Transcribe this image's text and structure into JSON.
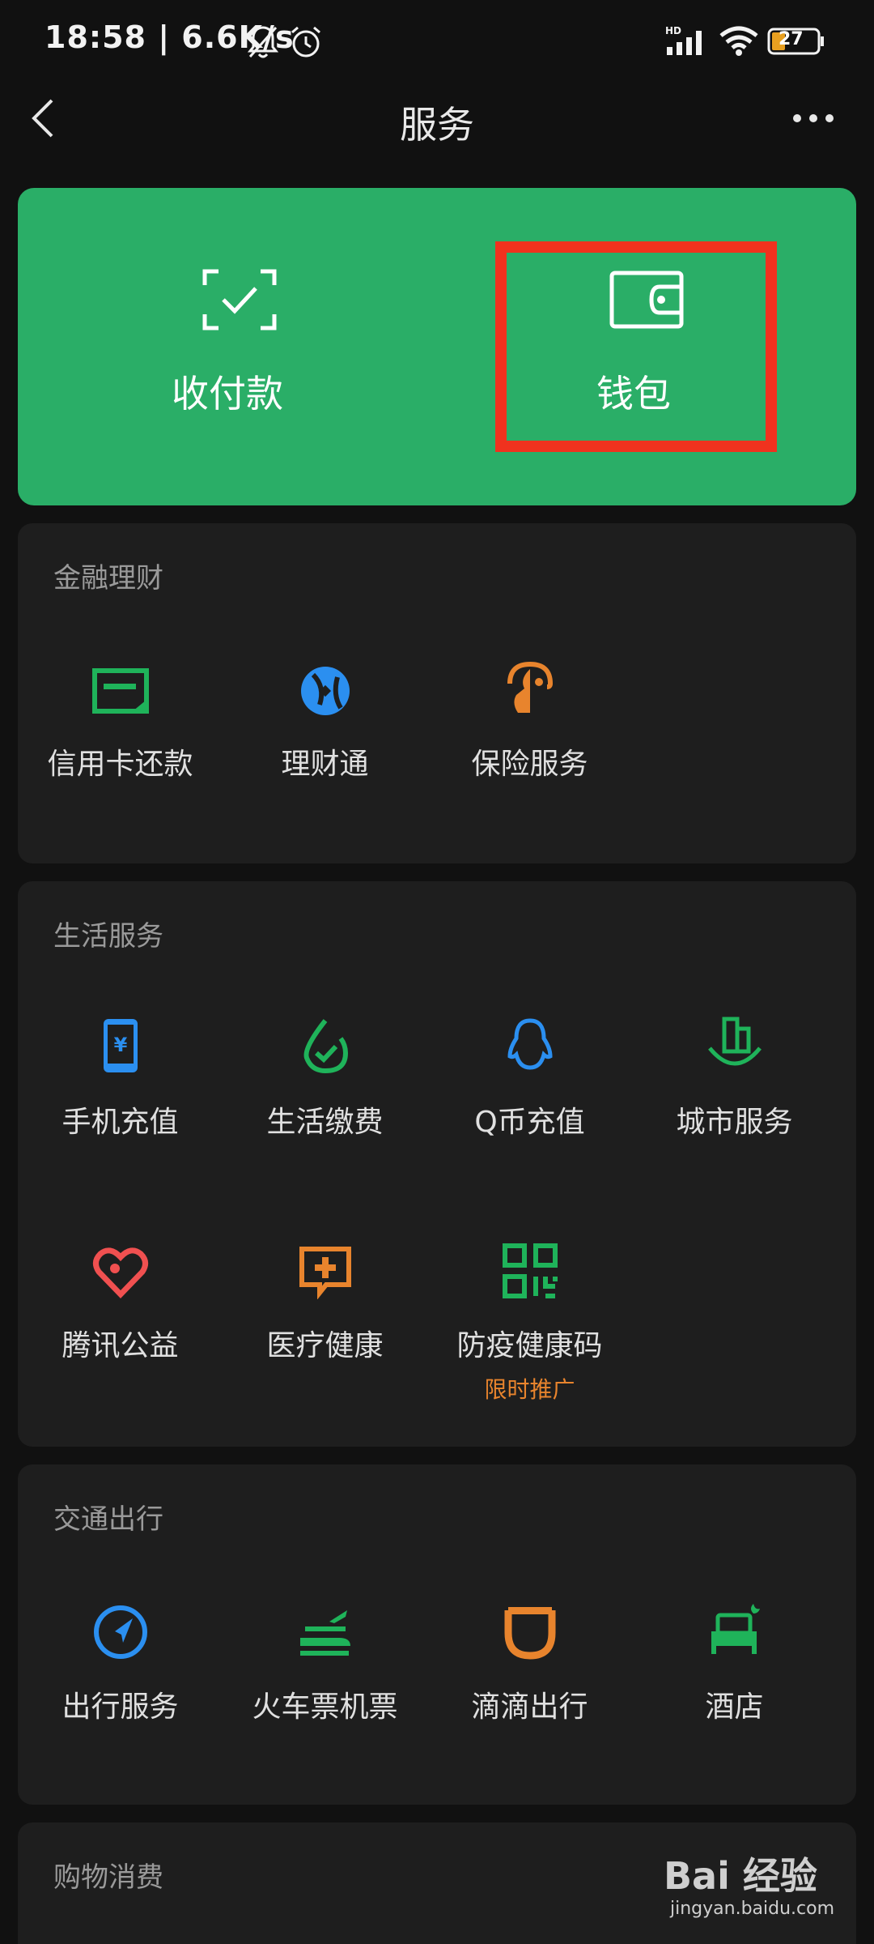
{
  "status_bar": {
    "time": "18:58 | 6.6K/s",
    "battery": "27",
    "network": "HD"
  },
  "nav": {
    "title": "服务",
    "back_icon": "chevron-left-icon",
    "more_icon": "more-icon"
  },
  "top_card": {
    "color": "#2aae67",
    "items": [
      {
        "label": "收付款",
        "icon": "scan-check-icon"
      },
      {
        "label": "钱包",
        "icon": "wallet-icon"
      }
    ],
    "highlight_color": "#f0321e"
  },
  "sections": [
    {
      "title": "金融理财",
      "items": [
        {
          "label": "信用卡还款",
          "icon": "credit-card-icon",
          "color": "#1fb35a"
        },
        {
          "label": "理财通",
          "icon": "licaitong-icon",
          "color": "#2b8ff0"
        },
        {
          "label": "保险服务",
          "icon": "insurance-icon",
          "color": "#e8842d"
        }
      ]
    },
    {
      "title": "生活服务",
      "items": [
        {
          "label": "手机充值",
          "icon": "phone-recharge-icon",
          "color": "#2b8ff0"
        },
        {
          "label": "生活缴费",
          "icon": "utility-bill-icon",
          "color": "#1fb35a"
        },
        {
          "label": "Q币充值",
          "icon": "qq-penguin-icon",
          "color": "#2b8ff0"
        },
        {
          "label": "城市服务",
          "icon": "city-service-icon",
          "color": "#1fb35a"
        },
        {
          "label": "腾讯公益",
          "icon": "charity-heart-icon",
          "color": "#f05050"
        },
        {
          "label": "医疗健康",
          "icon": "medical-icon",
          "color": "#e8842d"
        },
        {
          "label": "防疫健康码",
          "icon": "qr-code-icon",
          "color": "#1fb35a",
          "sub": "限时推广"
        }
      ]
    },
    {
      "title": "交通出行",
      "items": [
        {
          "label": "出行服务",
          "icon": "navigation-icon",
          "color": "#2b8ff0"
        },
        {
          "label": "火车票机票",
          "icon": "train-plane-icon",
          "color": "#1fb35a"
        },
        {
          "label": "滴滴出行",
          "icon": "didi-icon",
          "color": "#e8842d"
        },
        {
          "label": "酒店",
          "icon": "hotel-bed-icon",
          "color": "#1fb35a"
        }
      ]
    },
    {
      "title": "购物消费",
      "items": []
    }
  ],
  "watermark": {
    "text": "Bai 经验",
    "sub": "jingyan.baidu.com"
  }
}
